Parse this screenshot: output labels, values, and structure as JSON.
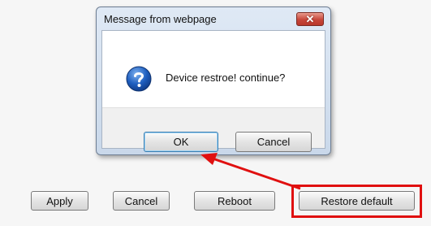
{
  "dialog": {
    "title": "Message from webpage",
    "close_glyph": "✕",
    "message": "Device restroe! continue?",
    "ok_label": "OK",
    "cancel_label": "Cancel",
    "icon": "question-icon"
  },
  "page": {
    "buttons": {
      "apply": "Apply",
      "cancel": "Cancel",
      "reboot": "Reboot",
      "restore_default": "Restore default"
    }
  },
  "annotation": {
    "color": "#e01010",
    "highlight": "restore-default-button",
    "arrow_target": "ok-button"
  }
}
